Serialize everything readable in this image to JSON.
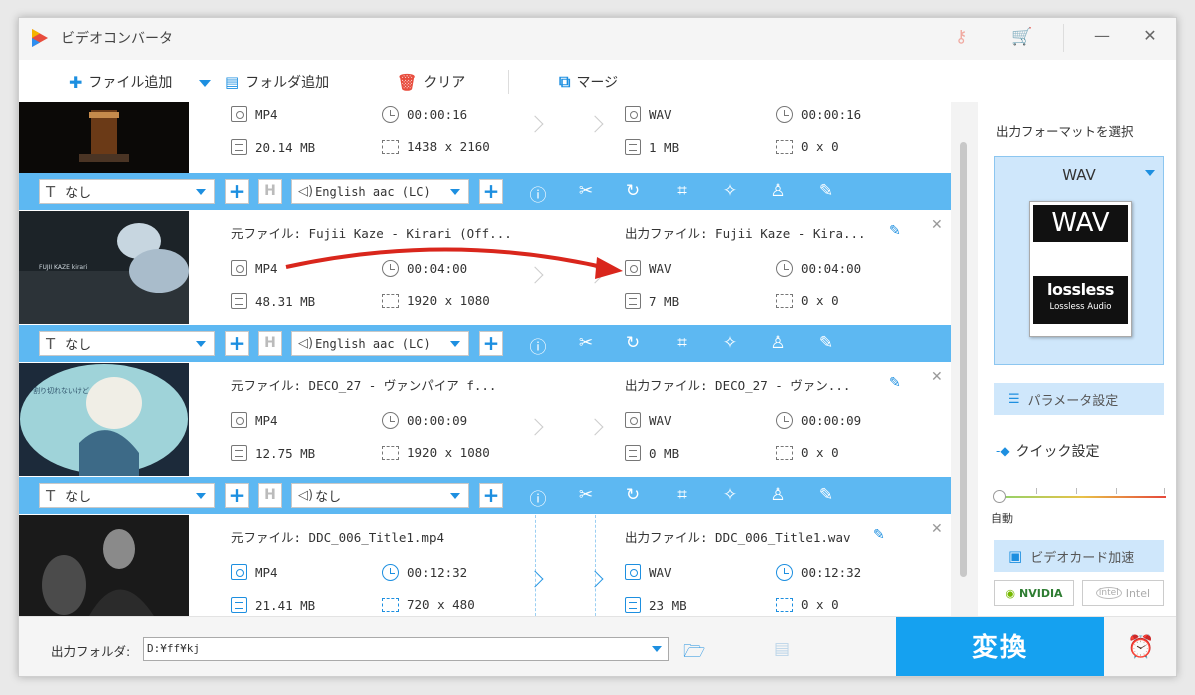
{
  "window": {
    "title": "ビデオコンバータ"
  },
  "toolbar": {
    "add_file": "ファイル追加",
    "add_folder": "フォルダ追加",
    "clear": "クリア",
    "merge": "マージ"
  },
  "rows": [
    {
      "src_label": "",
      "dst_label": "",
      "src": {
        "format": "MP4",
        "duration": "00:00:16",
        "size": "20.14 MB",
        "resolution": "1438 x 2160"
      },
      "dst": {
        "format": "WAV",
        "duration": "00:00:16",
        "size": "1 MB",
        "resolution": "0 x 0"
      }
    },
    {
      "src_label": "元ファイル: Fujii Kaze - Kirari (Off...",
      "dst_label": "出力ファイル: Fujii Kaze - Kira...",
      "src": {
        "format": "MP4",
        "duration": "00:04:00",
        "size": "48.31 MB",
        "resolution": "1920 x 1080"
      },
      "dst": {
        "format": "WAV",
        "duration": "00:04:00",
        "size": "7 MB",
        "resolution": "0 x 0"
      }
    },
    {
      "src_label": "元ファイル: DECO_27 - ヴァンパイア f...",
      "dst_label": "出力ファイル: DECO_27 - ヴァン...",
      "src": {
        "format": "MP4",
        "duration": "00:00:09",
        "size": "12.75 MB",
        "resolution": "1920 x 1080"
      },
      "dst": {
        "format": "WAV",
        "duration": "00:00:09",
        "size": "0 MB",
        "resolution": "0 x 0"
      }
    },
    {
      "src_label": "元ファイル: DDC_006_Title1.mp4",
      "dst_label": "出力ファイル: DDC_006_Title1.wav",
      "src": {
        "format": "MP4",
        "duration": "00:12:32",
        "size": "21.41 MB",
        "resolution": "720 x 480"
      },
      "dst": {
        "format": "WAV",
        "duration": "00:12:32",
        "size": "23 MB",
        "resolution": "0 x 0"
      }
    }
  ],
  "controls": [
    {
      "subtitle": "なし",
      "audio": "English aac (LC)"
    },
    {
      "subtitle": "なし",
      "audio": "English aac (LC)"
    },
    {
      "subtitle": "なし",
      "audio": "なし"
    }
  ],
  "side": {
    "title": "出力フォーマットを選択",
    "format": "WAV",
    "badge_top": "WAV",
    "badge_logo": "lossless",
    "badge_sub": "Lossless Audio",
    "params": "パラメータ設定",
    "quick": "クイック設定",
    "auto": "自動",
    "gpu": "ビデオカード加速",
    "nvidia": "NVIDIA",
    "intel": "Intel"
  },
  "bottom": {
    "out_label": "出力フォルダ:",
    "out_path": "D:¥ff¥kj",
    "convert": "変換"
  },
  "colors": {
    "accent": "#1d8fe0",
    "bar": "#5db8f2",
    "convert": "#15a1f0"
  }
}
